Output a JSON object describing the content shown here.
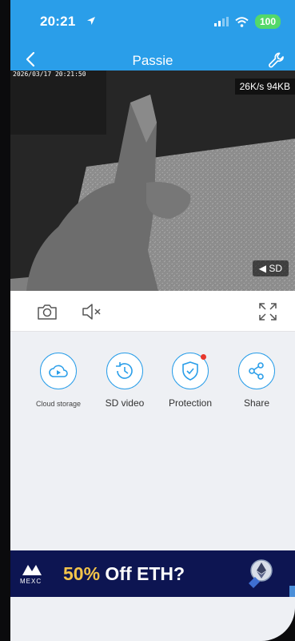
{
  "status": {
    "time": "20:21",
    "battery": "100"
  },
  "nav": {
    "title": "Passie"
  },
  "video": {
    "timestamp": "2026/03/17  20:21:50",
    "rate": "26K/s  94KB",
    "quality": "SD"
  },
  "actions": {
    "cloud": "Cloud storage",
    "sd": "SD video",
    "protection": "Protection",
    "share": "Share"
  },
  "ad": {
    "brand": "MEXC",
    "discount": "50%",
    "offer": " Off ETH?"
  },
  "colors": {
    "header": "#2a9ee9",
    "accent": "#2a9ee9",
    "ad_bg": "#0d1552",
    "ad_highlight": "#f3c44a"
  }
}
